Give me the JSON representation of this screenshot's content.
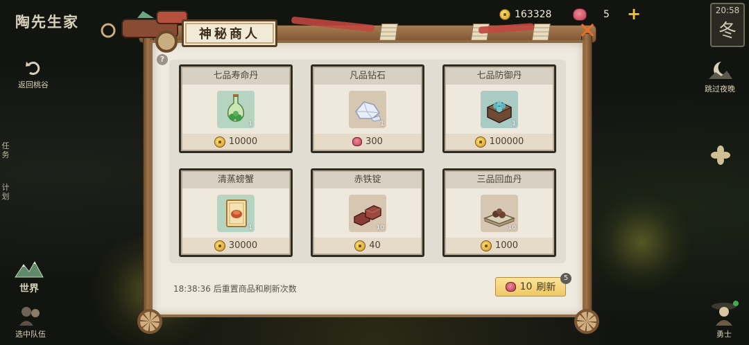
{
  "hud": {
    "game_title": "陶先生家",
    "gold": "163328",
    "gems": "5",
    "plus": "+",
    "time": "20:58",
    "season": "冬"
  },
  "left_menu": {
    "back": "返回桃谷",
    "quest": "任务",
    "plan": "计划",
    "world": "世界",
    "team": "选中队伍"
  },
  "right_menu": {
    "skip_night": "跳过夜晚",
    "hero": "勇士"
  },
  "shop": {
    "title": "神秘商人",
    "help": "?",
    "close": "✕",
    "items": [
      {
        "name": "七品寿命丹",
        "qty": "1",
        "currency": "coin",
        "price": "10000"
      },
      {
        "name": "凡品钻石",
        "qty": "1",
        "currency": "gem",
        "price": "300"
      },
      {
        "name": "七品防御丹",
        "qty": "1",
        "currency": "coin",
        "price": "100000"
      },
      {
        "name": "清蒸螃蟹",
        "qty": "1",
        "currency": "coin",
        "price": "30000"
      },
      {
        "name": "赤铁锭",
        "qty": "10",
        "currency": "coin",
        "price": "40"
      },
      {
        "name": "三品回血丹",
        "qty": "10",
        "currency": "coin",
        "price": "1000"
      }
    ],
    "reset_text": "18:38:36 后重置商品和刷新次数",
    "refresh_cost": "10",
    "refresh_label": "刷新",
    "refresh_badge": "5"
  },
  "colors": {
    "panel": "#efeadf",
    "frame": "#8e6a45",
    "accent_gold": "#f4c531",
    "close": "#e86f2a"
  }
}
